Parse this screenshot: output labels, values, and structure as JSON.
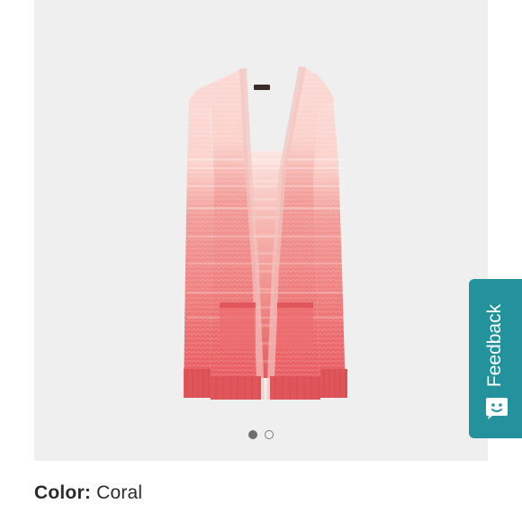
{
  "product": {
    "color_label": "Color:",
    "color_value": "Coral",
    "image_icon": "cardigan-photo"
  },
  "carousel": {
    "slide_count": 2,
    "active_index": 0
  },
  "feedback": {
    "label": "Feedback",
    "icon": "smiley-chat-icon"
  },
  "colors": {
    "gallery_bg": "#efefef",
    "feedback_bg": "#23929c",
    "coral": "#e95b60",
    "blush": "#fcd8d3"
  }
}
